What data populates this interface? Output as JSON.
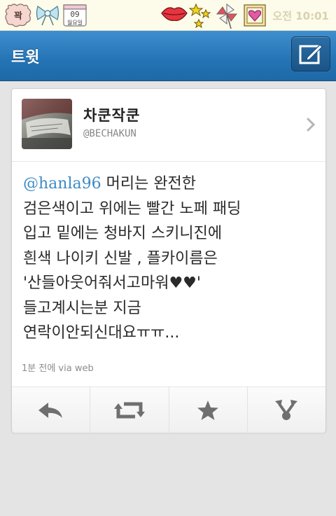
{
  "status_bar": {
    "stickers": [
      "kkwak-sticker",
      "ribbon-icon",
      "calendar-sticker",
      "lips-icon",
      "stars-icon",
      "pinwheel-icon",
      "heart-frame-icon"
    ],
    "calendar_text": "09\n월요일",
    "badge_text": "꽉",
    "time": "오전 10:01"
  },
  "header": {
    "title": "트윗",
    "compose_icon": "compose-icon",
    "accent": "#2474b5"
  },
  "tweet": {
    "display_name": "차쿤작쿤",
    "username": "@BECHAKUN",
    "mention": "@hanla96",
    "lines": [
      " 머리는 완전한",
      "검은색이고 위에는 빨간 노페 패딩",
      "입고 밑에는 청바지 스키니진에",
      "흰색 나이키 신발 , 플카이름은",
      "'산들아웃어줘서고마워♥♥'",
      "들고계시는분 지금",
      "연락이안되신대요ㅠㅠ..."
    ],
    "meta": "1분 전에 via web",
    "mention_color": "#3d8bc4"
  },
  "actions": [
    {
      "name": "reply",
      "icon": "reply-icon"
    },
    {
      "name": "retweet",
      "icon": "retweet-icon"
    },
    {
      "name": "favorite",
      "icon": "star-icon"
    },
    {
      "name": "more",
      "icon": "share-icon"
    }
  ]
}
